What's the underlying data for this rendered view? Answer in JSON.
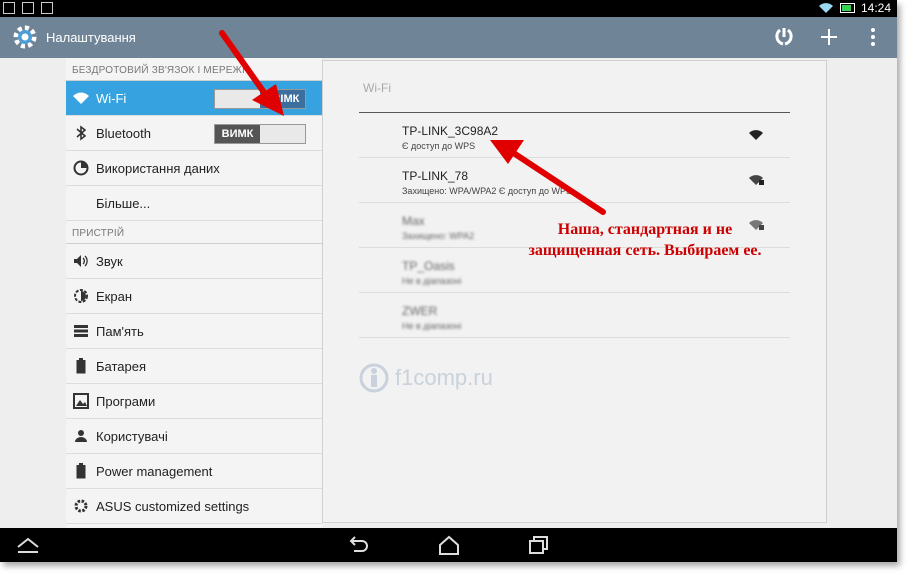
{
  "status_bar": {
    "time": "14:24"
  },
  "action_bar": {
    "title": "Налаштування"
  },
  "sidebar": {
    "sections": [
      {
        "header": "БЕЗДРОТОВИЙ ЗВ'ЯЗОК І МЕРЕЖІ"
      },
      {
        "header": "ПРИСТРІЙ"
      }
    ],
    "items": [
      {
        "label": "Wi-Fi",
        "toggle": "УВІМК",
        "icon": "wifi-icon",
        "active": true
      },
      {
        "label": "Bluetooth",
        "toggle": "ВИМК",
        "icon": "bluetooth-icon"
      },
      {
        "label": "Використання даних",
        "icon": "data-usage-icon"
      },
      {
        "label": "Більше...",
        "icon": ""
      },
      {
        "label": "Звук",
        "icon": "volume-icon"
      },
      {
        "label": "Екран",
        "icon": "brightness-icon"
      },
      {
        "label": "Пам'ять",
        "icon": "storage-icon"
      },
      {
        "label": "Батарея",
        "icon": "battery-icon"
      },
      {
        "label": "Програми",
        "icon": "apps-icon"
      },
      {
        "label": "Користувачі",
        "icon": "users-icon"
      },
      {
        "label": "Power management",
        "icon": "power-icon"
      },
      {
        "label": "ASUS customized settings",
        "icon": "gear-icon"
      }
    ]
  },
  "wifi_panel": {
    "header": "Wi-Fi",
    "networks": [
      {
        "ssid": "TP-LINK_3C98A2",
        "status": "Є доступ до WPS"
      },
      {
        "ssid": "TP-LINK_78",
        "status": "Захищено: WPA/WPA2 Є доступ до WPS"
      },
      {
        "ssid": "Max",
        "status": "Захищено: WPA2"
      },
      {
        "ssid": "TP_Oasis",
        "status": "Не в діапазоні"
      },
      {
        "ssid": "ZWER",
        "status": "Не в діапазоні"
      }
    ],
    "watermark": "f1comp.ru"
  },
  "annotation": {
    "line1": "Наша, стандартная и не",
    "line2": "защищенная сеть. Выбираем ее."
  },
  "colors": {
    "action_bar": "#6f8497",
    "selected_item": "#36a3e0",
    "annotation": "#cc0000"
  }
}
